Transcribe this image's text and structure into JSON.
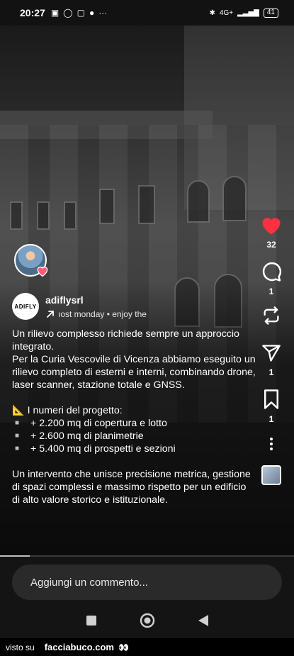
{
  "status_bar": {
    "time": "20:27",
    "notification_icons": [
      "n-icon",
      "whatsapp-icon",
      "message-icon",
      "facebook-icon",
      "more-icon"
    ],
    "signal_text": "4G+",
    "battery": "41"
  },
  "creator": {
    "username": "adiflysrl",
    "logo_text": "ADIFLY",
    "subline": "ıost monday • enjoy the"
  },
  "actions": {
    "likes": "32",
    "comments": "1",
    "reposts": "",
    "shares": "1",
    "saves": "1"
  },
  "caption": {
    "p1": "Un rilievo complesso richiede sempre un approccio integrato.",
    "p2": "Per la Curia Vescovile di Vicenza abbiamo eseguito un rilievo completo di esterni e interni, combinando drone, laser scanner, stazione totale e GNSS.",
    "numbers_title": "📐 I numeri del progetto:",
    "bullets": [
      "+ 2.200 mq di copertura e lotto",
      "+ 2.600 mq di planimetrie",
      "+ 5.400 mq di prospetti e sezioni"
    ],
    "p3": "Un intervento che unisce precisione metrica, gestione di spazi complessi e massimo rispetto per un edificio di alto valore storico e istituzionale."
  },
  "video_progress": 0.1,
  "comment_input": {
    "placeholder": "Aggiungi un commento..."
  },
  "footer": {
    "label": "visto su",
    "brand": "facciabuco.com",
    "eyes": "👀"
  },
  "colors": {
    "like_red": "#ff3040",
    "background": "#000000"
  }
}
